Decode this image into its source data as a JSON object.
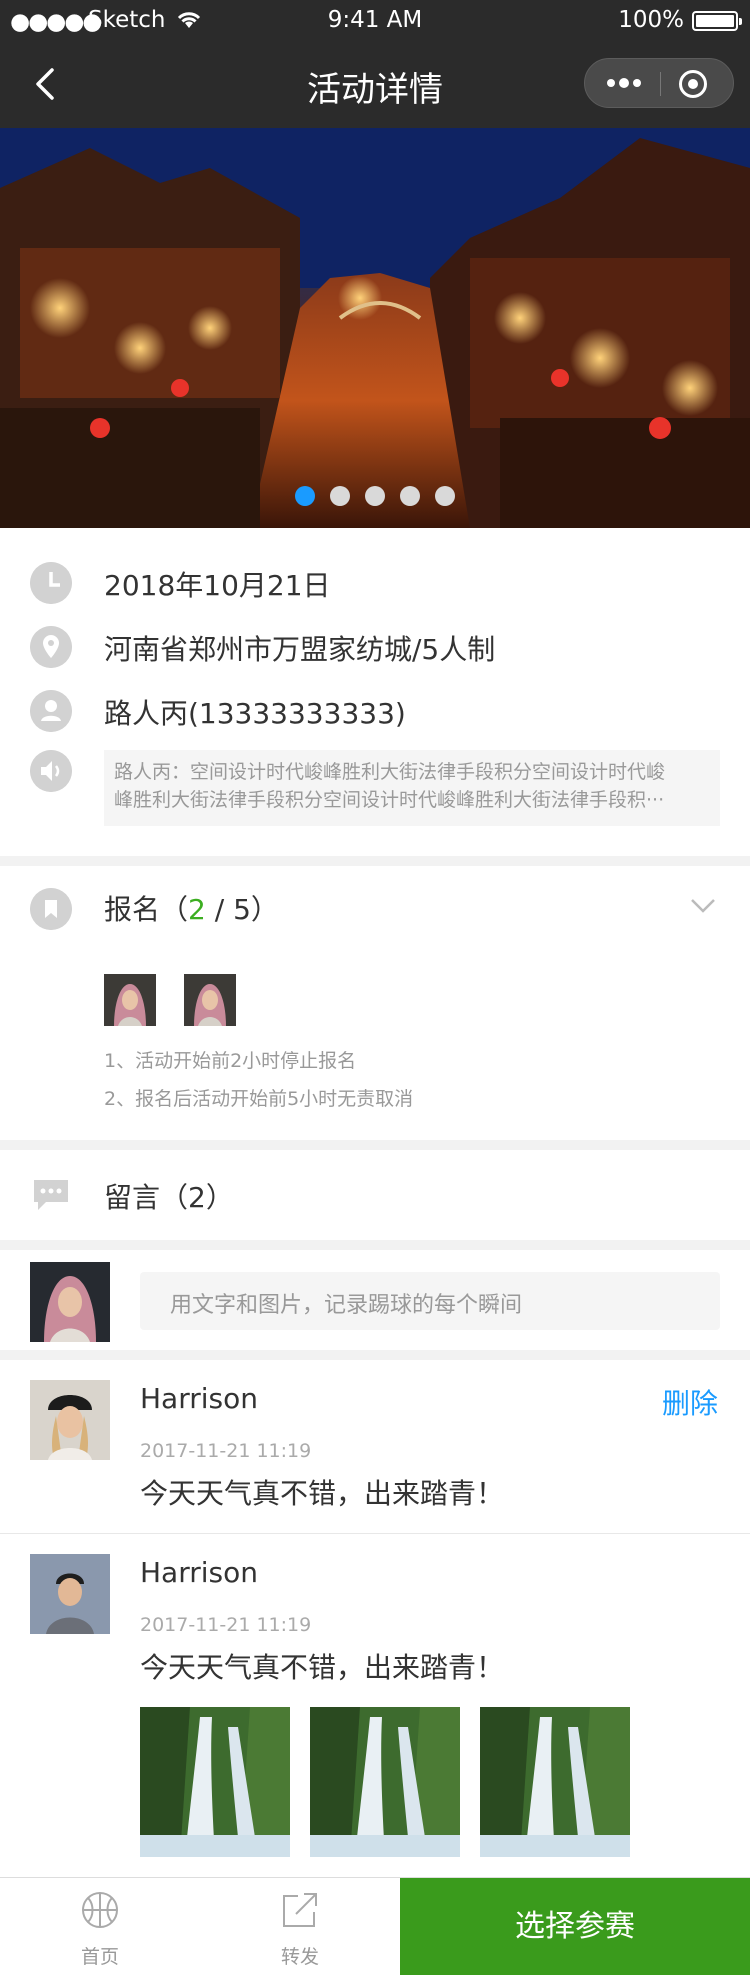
{
  "status_bar": {
    "carrier": "Sketch",
    "time": "9:41 AM",
    "battery": "100%"
  },
  "nav": {
    "title": "活动详情"
  },
  "banner": {
    "slide_count": 5,
    "active_slide": 1
  },
  "info": {
    "date": "2018年10月21日",
    "location": "河南省郑州市万盟家纺城/5人制",
    "contact": "路人丙(13333333333)",
    "notice_line1": "路人丙：空间设计时代峻峰胜利大街法律手段积分空间设计时代峻",
    "notice_line2": "峰胜利大街法律手段积分空间设计时代峻峰胜利大街法律手段积···"
  },
  "signup": {
    "label": "报名（",
    "count": "2",
    "sep": " / ",
    "total": "5",
    "close": "）",
    "rule1": "1、活动开始前2小时停止报名",
    "rule2": "2、报名后活动开始前5小时无责取消"
  },
  "messages": {
    "label": "留言（2）"
  },
  "compose": {
    "placeholder": "用文字和图片，记录踢球的每个瞬间"
  },
  "comments": [
    {
      "name": "Harrison",
      "time": "2017-11-21  11:19",
      "text": "今天天气真不错，出来踏青！",
      "delete": "删除"
    },
    {
      "name": "Harrison",
      "time": "2017-11-21  11:19",
      "text": "今天天气真不错，出来踏青！"
    }
  ],
  "tabbar": {
    "home": "首页",
    "share": "转发",
    "primary": "选择参赛"
  },
  "colors": {
    "accent_green": "#3a9b1c",
    "link_blue": "#1a9bff",
    "nav_bg": "#2b2b2b"
  }
}
